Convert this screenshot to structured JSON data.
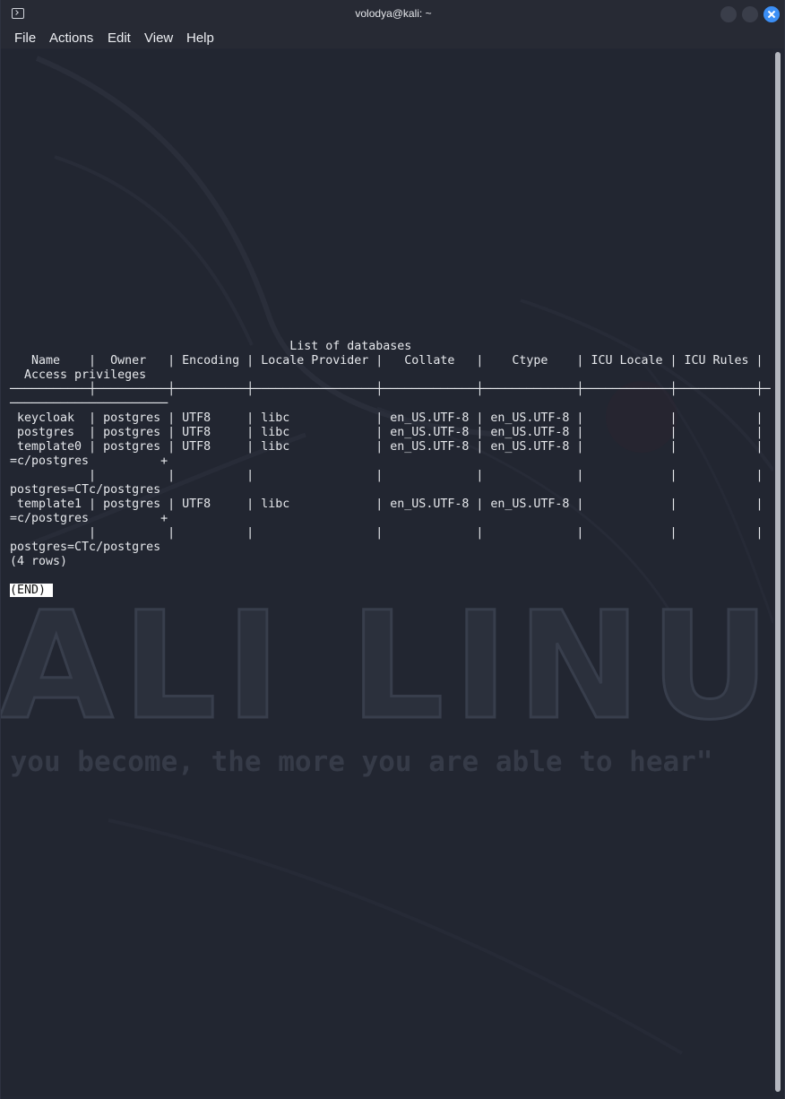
{
  "window": {
    "title": "volodya@kali: ~"
  },
  "menu": {
    "items": [
      "File",
      "Actions",
      "Edit",
      "View",
      "Help"
    ]
  },
  "terminal": {
    "lines": [
      "",
      "",
      "",
      "",
      "                                       List of databases",
      "   Name    |  Owner   | Encoding | Locale Provider |   Collate   |    Ctype    | ICU Locale | ICU Rules |",
      "  Access privileges",
      "───────────┼──────────┼──────────┼─────────────────┼─────────────┼─────────────┼────────────┼───────────┼─",
      "──────────────────────",
      " keycloak  | postgres | UTF8     | libc            | en_US.UTF-8 | en_US.UTF-8 |            |           |",
      " postgres  | postgres | UTF8     | libc            | en_US.UTF-8 | en_US.UTF-8 |            |           |",
      " template0 | postgres | UTF8     | libc            | en_US.UTF-8 | en_US.UTF-8 |            |           |",
      "=c/postgres          +",
      "           |          |          |                 |             |             |            |           |",
      "postgres=CTc/postgres",
      " template1 | postgres | UTF8     | libc            | en_US.UTF-8 | en_US.UTF-8 |            |           |",
      "=c/postgres          +",
      "           |          |          |                 |             |             |            |           |",
      "postgres=CTc/postgres",
      "(4 rows)",
      ""
    ],
    "pager_prompt": "(END)"
  },
  "wallpaper": {
    "logo_text": "KALI LINUX",
    "tagline": "\"the quieter you become, the more you are able to hear\""
  },
  "colors": {
    "background": "#222631",
    "titlebar": "#272a34",
    "close_button": "#3b8ff6",
    "text": "#e6e8ec"
  }
}
